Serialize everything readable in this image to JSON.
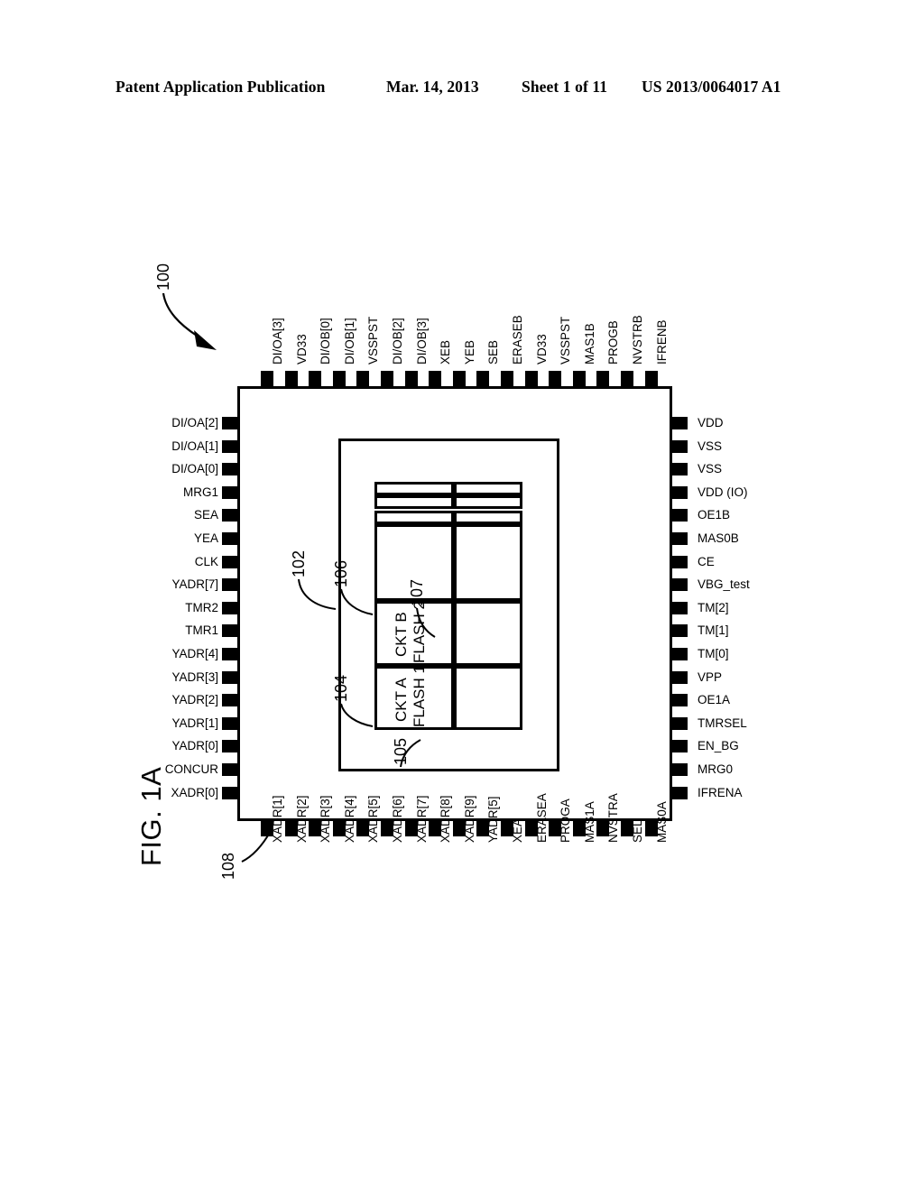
{
  "header": {
    "publication": "Patent Application Publication",
    "date": "Mar. 14, 2013",
    "sheet": "Sheet 1 of 11",
    "number": "US 2013/0064017 A1"
  },
  "figure": {
    "label": "FIG. 1A",
    "refs": {
      "chip": "100",
      "core": "102",
      "ckt_a": "104",
      "flash_1": "105",
      "array": "106",
      "flash_2": "107",
      "pin": "108"
    },
    "blocks": [
      {
        "id": "ckt-a",
        "line1": "CKT A",
        "line2": "FLASH 1"
      },
      {
        "id": "ckt-b",
        "line1": "CKT B",
        "line2": "FLASH 2"
      }
    ]
  },
  "pins": {
    "top": [
      "DI/OA[3]",
      "VD33",
      "DI/OB[0]",
      "DI/OB[1]",
      "VSSPST",
      "DI/OB[2]",
      "DI/OB[3]",
      "XEB",
      "YEB",
      "SEB",
      "ERASEB",
      "VD33",
      "VSSPST",
      "MAS1B",
      "PROGB",
      "NVSTRB",
      "IFRENB"
    ],
    "left": [
      "DI/OA[2]",
      "DI/OA[1]",
      "DI/OA[0]",
      "MRG1",
      "SEA",
      "YEA",
      "CLK",
      "YADR[7]",
      "TMR2",
      "TMR1",
      "YADR[4]",
      "YADR[3]",
      "YADR[2]",
      "YADR[1]",
      "YADR[0]",
      "CONCUR",
      "XADR[0]"
    ],
    "right": [
      "VDD",
      "VSS",
      "VSS",
      "VDD (IO)",
      "OE1B",
      "MAS0B",
      "CE",
      "VBG_test",
      "TM[2]",
      "TM[1]",
      "TM[0]",
      "VPP",
      "OE1A",
      "TMRSEL",
      "EN_BG",
      "MRG0",
      "IFRENA"
    ],
    "bottom": [
      "XADR[1]",
      "XADR[2]",
      "XADR[3]",
      "XADR[4]",
      "XADR[5]",
      "XADR[6]",
      "XADR[7]",
      "XADR[8]",
      "XADR[9]",
      "YADR[5]",
      "XEA",
      "ERASEA",
      "PROGA",
      "MAS1A",
      "NVSTRA",
      "SEL",
      "MAS0A"
    ]
  },
  "colors": {
    "ink": "#000000",
    "paper": "#ffffff"
  }
}
